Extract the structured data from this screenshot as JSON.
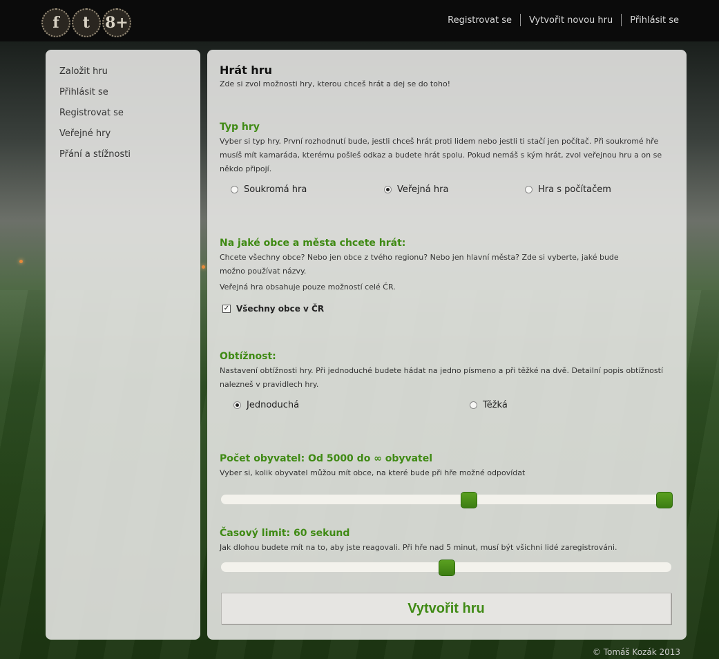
{
  "social": {
    "facebook": {
      "icon": "facebook-icon",
      "glyph": "f"
    },
    "twitter": {
      "icon": "twitter-icon",
      "glyph": "t"
    },
    "googleplus": {
      "icon": "googleplus-icon",
      "glyph": "8+"
    }
  },
  "topnav": {
    "register": "Registrovat se",
    "new_game": "Vytvořit novou hru",
    "login": "Přihlásit se"
  },
  "sidebar": {
    "items": [
      {
        "label": "Založit hru"
      },
      {
        "label": "Přihlásit se"
      },
      {
        "label": "Registrovat se"
      },
      {
        "label": "Veřejné hry"
      },
      {
        "label": "Přání a stížnosti"
      }
    ]
  },
  "main": {
    "title": "Hrát hru",
    "subtitle": "Zde si zvol možnosti hry, kterou chceš hrát a dej se do toho!",
    "game_type": {
      "heading": "Typ hry",
      "desc": "Vyber si typ hry. První rozhodnutí bude, jestli chceš hrát proti lidem nebo jestli ti stačí jen počítač. Při soukromé hře musíš mít kamaráda, kterému pošleš odkaz a budete hrát spolu. Pokud nemáš s kým hrát, zvol veřejnou hru a on se někdo připojí.",
      "options": [
        {
          "label": "Soukromá hra",
          "checked": false
        },
        {
          "label": "Veřejná hra",
          "checked": true
        },
        {
          "label": "Hra s počítačem",
          "checked": false
        }
      ]
    },
    "cities": {
      "heading": "Na jaké obce a města chcete hrát:",
      "desc": "Chcete všechny obce? Nebo jen obce z tvého regionu? Nebo jen hlavní města? Zde si vyberte, jaké bude možno používat názvy.",
      "note": "Veřejná hra obsahuje pouze možností celé ČR.",
      "checkbox_label": "Všechny obce v ČR",
      "checkbox_checked": true
    },
    "difficulty": {
      "heading": "Obtížnost:",
      "desc": "Nastavení obtížnosti hry. Při jednoduché budete hádat na jedno písmeno a při těžké na dvě. Detailní popis obtížností nalezneš v pravidlech hry.",
      "options": [
        {
          "label": "Jednoduchá",
          "checked": true
        },
        {
          "label": "Těžká",
          "checked": false
        }
      ]
    },
    "population": {
      "heading": "Počet obyvatel: Od 5000 do ∞ obyvatel",
      "desc": "Vyber si, kolik obyvatel můžou mít obce, na které bude při hře možné odpovídat",
      "range_low_fraction": 0.55,
      "range_high_fraction": 1.0
    },
    "time_limit": {
      "heading": "Časový limit: 60 sekund",
      "desc": "Jak dlohou budete mít na to, aby jste reagovali. Při hře nad 5 minut, musí být všichni lidé zaregistrováni.",
      "value_fraction": 0.5
    },
    "create_button": "Vytvořit hru"
  },
  "footer": "© Tomáš Kozák 2013",
  "colors": {
    "accent": "#3f8a14",
    "handle": "#4a9418"
  }
}
